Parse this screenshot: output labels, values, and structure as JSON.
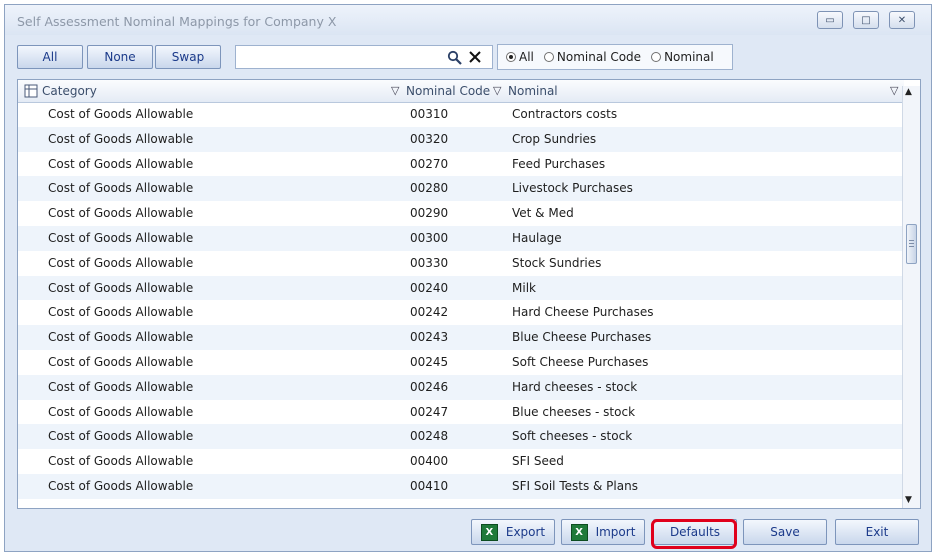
{
  "window": {
    "title": "Self Assessment Nominal Mappings for Company X"
  },
  "toolbar": {
    "all_label": "All",
    "none_label": "None",
    "swap_label": "Swap",
    "search_value": "",
    "radios": [
      {
        "label": "All",
        "selected": true
      },
      {
        "label": "Nominal Code",
        "selected": false
      },
      {
        "label": "Nominal",
        "selected": false
      }
    ]
  },
  "grid": {
    "columns": [
      "Category",
      "Nominal Code",
      "Nominal"
    ],
    "rows": [
      [
        "Cost of Goods Allowable",
        "00310",
        "Contractors costs"
      ],
      [
        "Cost of Goods Allowable",
        "00320",
        "Crop Sundries"
      ],
      [
        "Cost of Goods Allowable",
        "00270",
        "Feed Purchases"
      ],
      [
        "Cost of Goods Allowable",
        "00280",
        "Livestock Purchases"
      ],
      [
        "Cost of Goods Allowable",
        "00290",
        "Vet & Med"
      ],
      [
        "Cost of Goods Allowable",
        "00300",
        "Haulage"
      ],
      [
        "Cost of Goods Allowable",
        "00330",
        "Stock Sundries"
      ],
      [
        "Cost of Goods Allowable",
        "00240",
        "Milk"
      ],
      [
        "Cost of Goods Allowable",
        "00242",
        "Hard Cheese Purchases"
      ],
      [
        "Cost of Goods Allowable",
        "00243",
        "Blue Cheese Purchases"
      ],
      [
        "Cost of Goods Allowable",
        "00245",
        "Soft  Cheese Purchases"
      ],
      [
        "Cost of Goods Allowable",
        "00246",
        "Hard cheeses - stock"
      ],
      [
        "Cost of Goods Allowable",
        "00247",
        "Blue cheeses - stock"
      ],
      [
        "Cost of Goods Allowable",
        "00248",
        "Soft cheeses - stock"
      ],
      [
        "Cost of Goods Allowable",
        "00400",
        "SFI Seed"
      ],
      [
        "Cost of Goods Allowable",
        "00410",
        "SFI Soil Tests & Plans"
      ]
    ]
  },
  "footer": {
    "export_label": "Export",
    "import_label": "Import",
    "defaults_label": "Defaults",
    "save_label": "Save",
    "exit_label": "Exit",
    "excel_icon_text": "X"
  },
  "colors": {
    "highlight": "#e0001b",
    "accent": "#1b3a8a"
  }
}
